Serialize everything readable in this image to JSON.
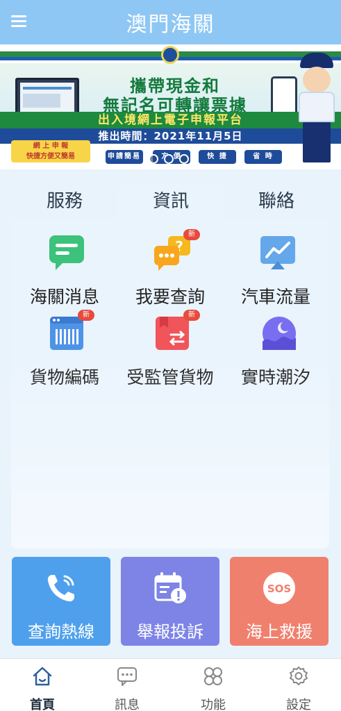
{
  "header": {
    "title": "澳門海關",
    "menu_icon": "hamburger-menu-icon"
  },
  "banner": {
    "line1": "攜帶現金和",
    "line2": "無記名可轉讓票據",
    "line3": "出入境網上電子申報平台",
    "date": "推出時間：2021年11月5日",
    "badge_line1": "網 上 申 報",
    "badge_line2": "快捷方便又簡易",
    "pills": [
      "申請簡易",
      "方 便",
      "快 捷",
      "省 時"
    ],
    "carousel_dots": 3,
    "active_dot": 1
  },
  "tabs": [
    {
      "label": "服務",
      "active": false
    },
    {
      "label": "資訊",
      "active": true
    },
    {
      "label": "聯絡",
      "active": false
    }
  ],
  "grid": [
    {
      "label": "海關消息",
      "icon": "chat-news-icon",
      "new": false
    },
    {
      "label": "我要查詢",
      "icon": "inquiry-chat-icon",
      "new": true,
      "badge": "新"
    },
    {
      "label": "汽車流量",
      "icon": "traffic-chart-icon",
      "new": false
    },
    {
      "label": "貨物編碼",
      "icon": "cargo-barcode-icon",
      "new": true,
      "badge": "新"
    },
    {
      "label": "受監管貨物",
      "icon": "controlled-goods-icon",
      "new": true,
      "badge": "新"
    },
    {
      "label": "實時潮汐",
      "icon": "tide-wave-icon",
      "new": false
    }
  ],
  "cards": [
    {
      "label": "查詢熱線",
      "icon": "phone-icon",
      "color": "#4fa0ec"
    },
    {
      "label": "舉報投訴",
      "icon": "calendar-alert-icon",
      "color": "#7d84e6"
    },
    {
      "label": "海上救援",
      "icon": "sos-icon",
      "color": "#f0806e",
      "icon_text": "SOS"
    }
  ],
  "nav": [
    {
      "label": "首頁",
      "icon": "home-icon",
      "active": true
    },
    {
      "label": "訊息",
      "icon": "message-icon",
      "active": false
    },
    {
      "label": "功能",
      "icon": "function-icon",
      "active": false
    },
    {
      "label": "設定",
      "icon": "settings-icon",
      "active": false
    }
  ],
  "colors": {
    "header_bg": "#8fc7f4",
    "accent": "#1f4c9a"
  }
}
